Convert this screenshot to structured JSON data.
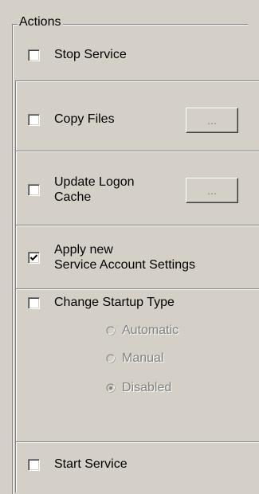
{
  "group": {
    "title": "Actions"
  },
  "actions": {
    "stop_service": {
      "label": "Stop Service",
      "checked": false
    },
    "copy_files": {
      "label": "Copy Files",
      "checked": false,
      "browse_label": "..."
    },
    "update_logon_cache": {
      "label_line1": "Update Logon",
      "label_line2": "Cache",
      "checked": false,
      "browse_label": "..."
    },
    "apply_account_settings": {
      "label_line1": "Apply new",
      "label_line2": "Service Account Settings",
      "checked": true
    },
    "change_startup_type": {
      "label": "Change Startup Type",
      "checked": false,
      "options": [
        {
          "label": "Automatic",
          "selected": false
        },
        {
          "label": "Manual",
          "selected": false
        },
        {
          "label": "Disabled",
          "selected": true
        }
      ]
    },
    "start_service": {
      "label": "Start Service",
      "checked": false
    }
  },
  "colors": {
    "face": "#d4d0c8",
    "shadow": "#808080",
    "highlight": "#ffffff",
    "disabled_text": "#808080"
  }
}
